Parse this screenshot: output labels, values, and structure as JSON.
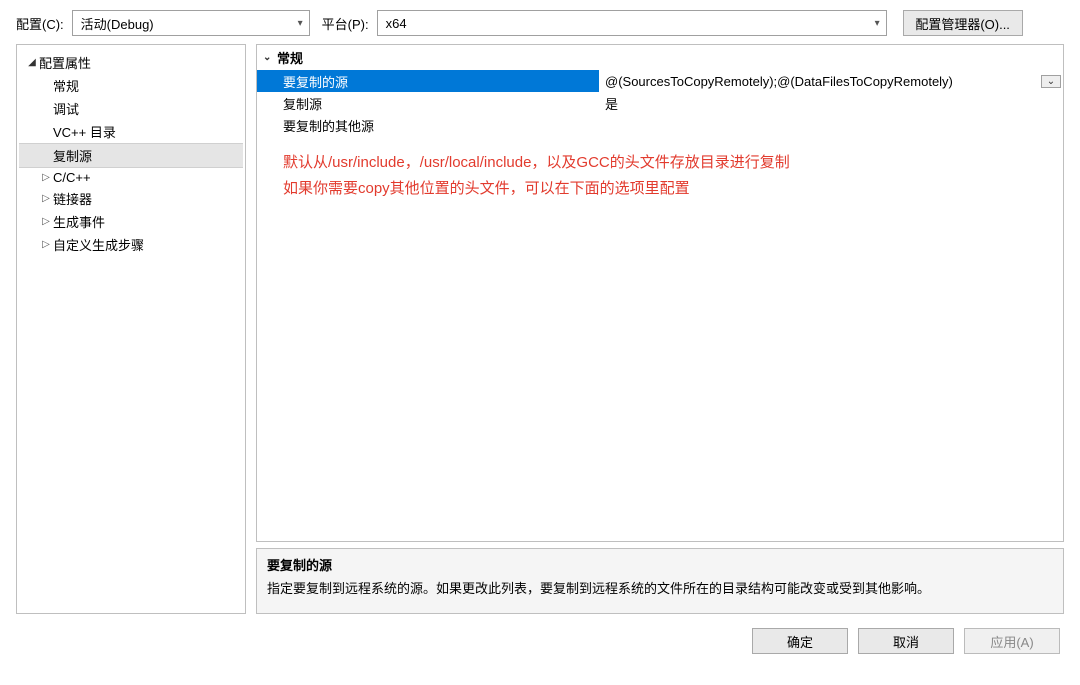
{
  "toolbar": {
    "config_label": "配置(C):",
    "config_value": "活动(Debug)",
    "platform_label": "平台(P):",
    "platform_value": "x64",
    "manager_btn": "配置管理器(O)..."
  },
  "tree": {
    "root": "配置属性",
    "items": [
      {
        "label": "常规",
        "expander": ""
      },
      {
        "label": "调试",
        "expander": ""
      },
      {
        "label": "VC++ 目录",
        "expander": ""
      },
      {
        "label": "复制源",
        "expander": "",
        "selected": true
      },
      {
        "label": "C/C++",
        "expander": "▷"
      },
      {
        "label": "链接器",
        "expander": "▷"
      },
      {
        "label": "生成事件",
        "expander": "▷"
      },
      {
        "label": "自定义生成步骤",
        "expander": "▷"
      }
    ]
  },
  "propgrid": {
    "category": "常规",
    "rows": [
      {
        "label": "要复制的源",
        "value": "@(SourcesToCopyRemotely);@(DataFilesToCopyRemotely)",
        "selected": true
      },
      {
        "label": "复制源",
        "value": "是"
      },
      {
        "label": "要复制的其他源",
        "value": ""
      }
    ],
    "annotation_line1": "默认从/usr/include，/usr/local/include，以及GCC的头文件存放目录进行复制",
    "annotation_line2": "如果你需要copy其他位置的头文件，可以在下面的选项里配置"
  },
  "description": {
    "title": "要复制的源",
    "body": "指定要复制到远程系统的源。如果更改此列表，要复制到远程系统的文件所在的目录结构可能改变或受到其他影响。"
  },
  "footer": {
    "ok": "确定",
    "cancel": "取消",
    "apply": "应用(A)"
  }
}
